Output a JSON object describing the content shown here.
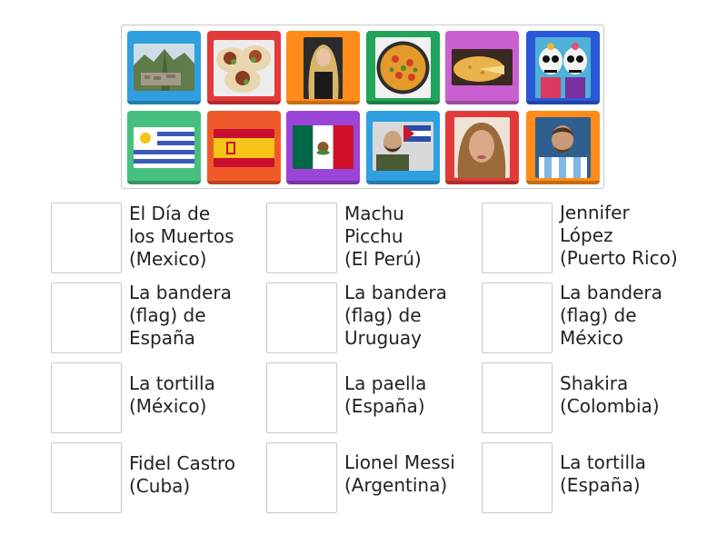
{
  "activity": {
    "tiles": [
      {
        "name": "machu-picchu-image",
        "color": "#2f9fe0"
      },
      {
        "name": "tacos-image",
        "color": "#e23a3a"
      },
      {
        "name": "shakira-photo",
        "color": "#ff8c1a"
      },
      {
        "name": "paella-image",
        "color": "#22a55a"
      },
      {
        "name": "spanish-tortilla-image",
        "color": "#c95fd1"
      },
      {
        "name": "dia-de-los-muertos-image",
        "color": "#2b58d8"
      },
      {
        "name": "uruguay-flag-image",
        "color": "#46c07f"
      },
      {
        "name": "spain-flag-image",
        "color": "#f05a28"
      },
      {
        "name": "mexico-flag-image",
        "color": "#9a45d8"
      },
      {
        "name": "fidel-castro-photo",
        "color": "#2f9fe0"
      },
      {
        "name": "jennifer-lopez-photo",
        "color": "#e23a3a"
      },
      {
        "name": "lionel-messi-photo",
        "color": "#ff8c1a"
      }
    ],
    "targets": [
      {
        "label": "El Día de\nlos Muertos\n(Mexico)"
      },
      {
        "label": "Machu\nPicchu\n(El Perú)"
      },
      {
        "label": " Jennifer\nLópez\n(Puerto Rico)"
      },
      {
        "label": "La bandera\n(flag) de\nEspaña"
      },
      {
        "label": "La bandera\n(flag) de\nUruguay"
      },
      {
        "label": "La bandera\n(flag) de\nMéxico"
      },
      {
        "label": "La tortilla\n(México)"
      },
      {
        "label": "La paella\n(España)"
      },
      {
        "label": "Shakira\n(Colombia)"
      },
      {
        "label": "Fidel Castro\n(Cuba)"
      },
      {
        "label": "Lionel Messi\n(Argentina)"
      },
      {
        "label": "La tortilla\n(España)"
      }
    ]
  }
}
